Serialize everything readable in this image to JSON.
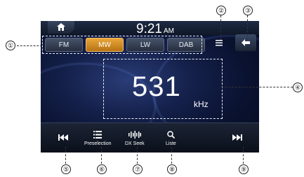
{
  "clock": {
    "time": "9:21",
    "ampm": "AM"
  },
  "bands": [
    {
      "label": "FM",
      "active": false
    },
    {
      "label": "MW",
      "active": true
    },
    {
      "label": "LW",
      "active": false
    },
    {
      "label": "DAB",
      "active": false
    }
  ],
  "frequency": {
    "value": "531",
    "unit": "kHz"
  },
  "bottom": {
    "preselection": "Preselection",
    "dxseek": "DX Seek",
    "liste": "Liste"
  },
  "callouts": [
    "①",
    "②",
    "③",
    "④",
    "⑤",
    "⑥",
    "⑦",
    "⑧",
    "⑨"
  ],
  "colors": {
    "active_band": "#e9a63a",
    "background": "#0a1230"
  }
}
